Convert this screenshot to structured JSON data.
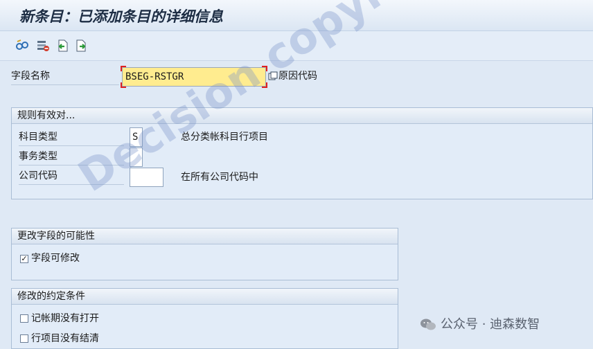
{
  "window": {
    "title": "新条目：已添加条目的详细信息"
  },
  "field_row": {
    "label": "字段名称",
    "value": "BSEG-RSTGR",
    "description": "原因代码"
  },
  "group_validity": {
    "title": "规则有效对...",
    "rows": [
      {
        "label": "科目类型",
        "value": "S",
        "description": "总分类帐科目行项目"
      },
      {
        "label": "事务类型",
        "value": "",
        "description": ""
      },
      {
        "label": "公司代码",
        "value": "",
        "description": "在所有公司代码中"
      }
    ]
  },
  "group_change": {
    "title": "更改字段的可能性",
    "checkbox_label": "字段可修改",
    "checked": true
  },
  "group_conditions": {
    "title": "修改的约定条件",
    "items": [
      {
        "label": "记帐期没有打开",
        "checked": false
      },
      {
        "label": "行项目没有结清",
        "checked": false
      }
    ]
  },
  "watermark": "Decision copyright",
  "wechat_label": "公众号 · 迪森数智",
  "colors": {
    "highlight_input": "#ffec8f",
    "background": "#dfe9f5"
  },
  "toolbar_icons": [
    "glasses-icon",
    "delete-row-icon",
    "previous-entry-icon",
    "next-entry-icon"
  ]
}
